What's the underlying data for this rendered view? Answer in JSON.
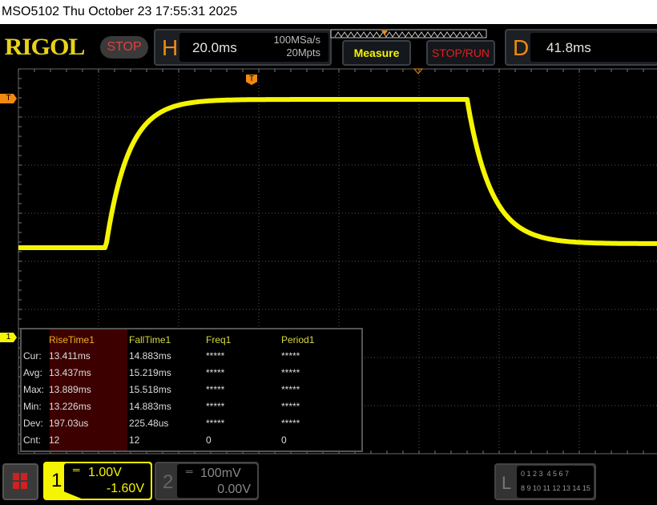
{
  "titlebar": {
    "text": "MSO5102  Thu October 23 17:55:31 2025"
  },
  "header": {
    "logo": "RIGOL",
    "run_state": "STOP",
    "h_label": "H",
    "timebase": "20.0ms",
    "sample_rate": "100MSa/s",
    "memory_depth": "20Mpts",
    "measure_button": "Measure",
    "stoprun_button": "STOP/RUN",
    "d_label": "D",
    "delay": "41.8ms"
  },
  "markers": {
    "trigger_level": "T",
    "trigger_position": "T",
    "ch1_offset": "1"
  },
  "measurements": {
    "columns": [
      "RiseTime1",
      "FallTime1",
      "Freq1",
      "Period1"
    ],
    "rows": [
      {
        "label": "Cur:",
        "values": [
          "13.411ms",
          "14.883ms",
          "*****",
          "*****"
        ]
      },
      {
        "label": "Avg:",
        "values": [
          "13.437ms",
          "15.219ms",
          "*****",
          "*****"
        ]
      },
      {
        "label": "Max:",
        "values": [
          "13.889ms",
          "15.518ms",
          "*****",
          "*****"
        ]
      },
      {
        "label": "Min:",
        "values": [
          "13.226ms",
          "14.883ms",
          "*****",
          "*****"
        ]
      },
      {
        "label": "Dev:",
        "values": [
          "197.03us",
          "225.48us",
          "*****",
          "*****"
        ]
      },
      {
        "label": "Cnt:",
        "values": [
          "12",
          "12",
          "0",
          "0"
        ]
      }
    ]
  },
  "channels": [
    {
      "number": "1",
      "scale": "1.00V",
      "offset": "-1.60V",
      "color": "#f5f500",
      "active": true
    },
    {
      "number": "2",
      "scale": "100mV",
      "offset": "0.00V",
      "color": "#888888",
      "active": false
    }
  ],
  "logic": {
    "label": "L",
    "row1": "0 1 2 3  4 5 6 7",
    "row2": "8 9 10 11 12 13 14 15"
  },
  "colors": {
    "trace": "#f5f500",
    "accent": "#f08a10"
  }
}
